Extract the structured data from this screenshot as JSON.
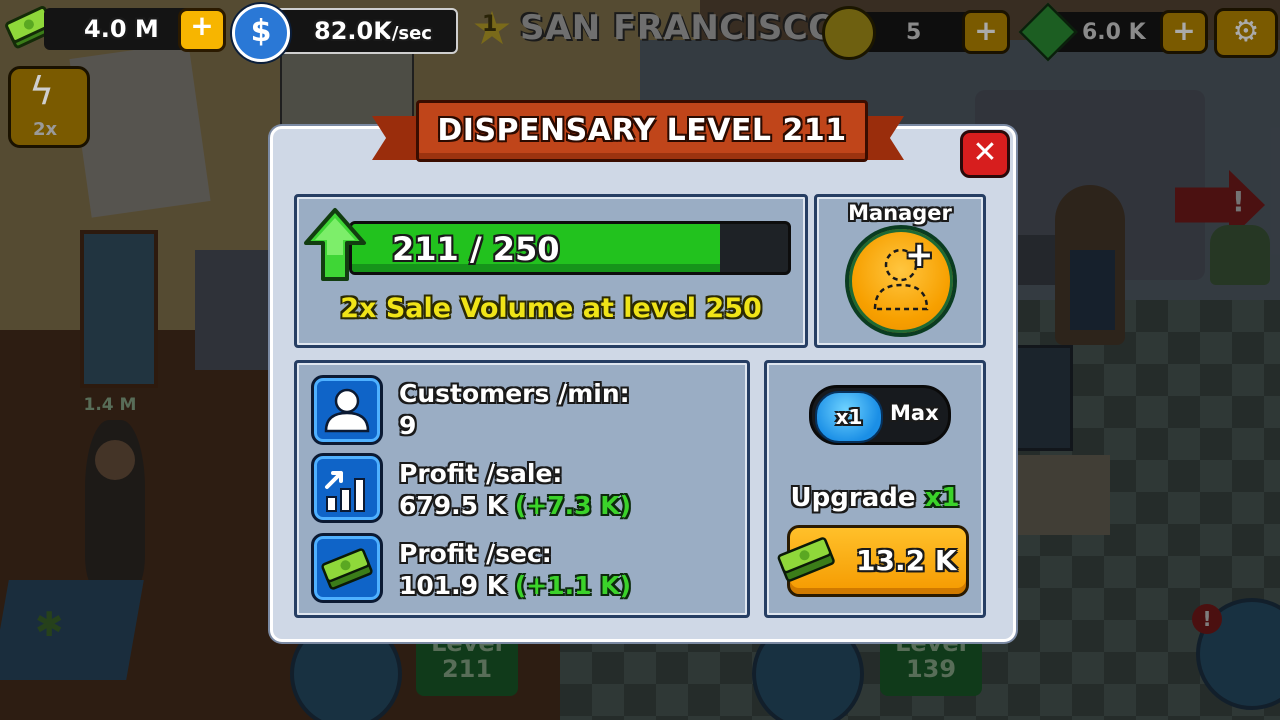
{
  "hud": {
    "cash": "4.0 M",
    "cash_plus": "+",
    "income": "82.0K",
    "income_unit": "/sec",
    "city_rank": "1",
    "city": "SAN FRANCISCO",
    "coins": "5",
    "coins_plus": "+",
    "gems": "6.0 K",
    "gems_plus": "+",
    "settings_icon": "gear-icon"
  },
  "side": {
    "boost_label": "2x",
    "boost_icon": "lightning-icon"
  },
  "scene": {
    "customer_value": "1.4 M",
    "level_left_word": "Level",
    "level_left": "211",
    "level_right_word": "Level",
    "level_right": "139"
  },
  "dialog": {
    "title": "DISPENSARY LEVEL 211",
    "close_symbol": "✕",
    "progress": {
      "current": 211,
      "max": 250,
      "text": "211 / 250",
      "fraction": 0.844
    },
    "milestone": "2x Sale Volume at level 250",
    "manager": {
      "label": "Manager",
      "plus": "+"
    },
    "stats": [
      {
        "icon": "customer-icon",
        "label": "Customers /min:",
        "value": "9",
        "delta": ""
      },
      {
        "icon": "chart-icon",
        "label": "Profit /sale:",
        "value": "679.5 K",
        "delta": "(+7.3 K)"
      },
      {
        "icon": "cash-icon",
        "label": "Profit /sec:",
        "value": "101.9 K",
        "delta": "(+1.1 K)"
      }
    ],
    "multiplier": {
      "options": [
        "x1",
        "Max"
      ],
      "selected": "x1"
    },
    "upgrade": {
      "label": "Upgrade",
      "mult": "x1",
      "cost": "13.2 K"
    }
  },
  "colors": {
    "progress_fill": "#22c21e",
    "ribbon": "#c0451a",
    "dialog_bg": "#cfd8e6",
    "panel_bg": "#9aadc4",
    "upgrade_btn": "#f7a600",
    "close_btn": "#d71e1e"
  }
}
